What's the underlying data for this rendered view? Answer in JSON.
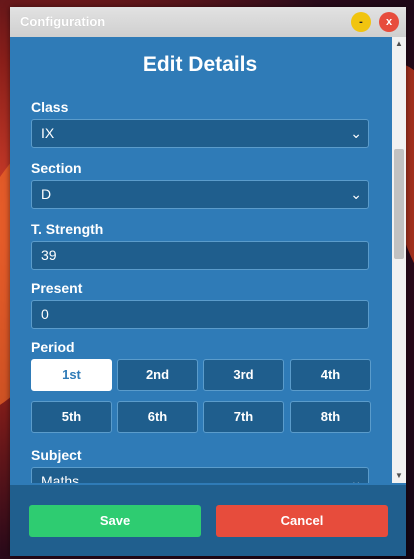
{
  "window": {
    "title": "Configuration",
    "minimize_label": "-",
    "close_label": "x"
  },
  "form": {
    "heading": "Edit Details",
    "class": {
      "label": "Class",
      "value": "IX"
    },
    "section": {
      "label": "Section",
      "value": "D"
    },
    "strength": {
      "label": "T. Strength",
      "value": "39"
    },
    "present": {
      "label": "Present",
      "value": "0"
    },
    "period": {
      "label": "Period",
      "options": [
        "1st",
        "2nd",
        "3rd",
        "4th",
        "5th",
        "6th",
        "7th",
        "8th"
      ],
      "selected": "1st"
    },
    "subject": {
      "label": "Subject",
      "value": "Maths"
    }
  },
  "footer": {
    "save_label": "Save",
    "cancel_label": "Cancel"
  },
  "icons": {
    "chevron": "chevron-down-icon",
    "scroll_up": "scroll-up-arrow-icon",
    "scroll_down": "scroll-down-arrow-icon"
  },
  "colors": {
    "panel": "#2f7bb7",
    "field": "#1f5e8d",
    "save": "#2ecc71",
    "cancel": "#e74c3c",
    "minimize": "#f1c40f"
  }
}
